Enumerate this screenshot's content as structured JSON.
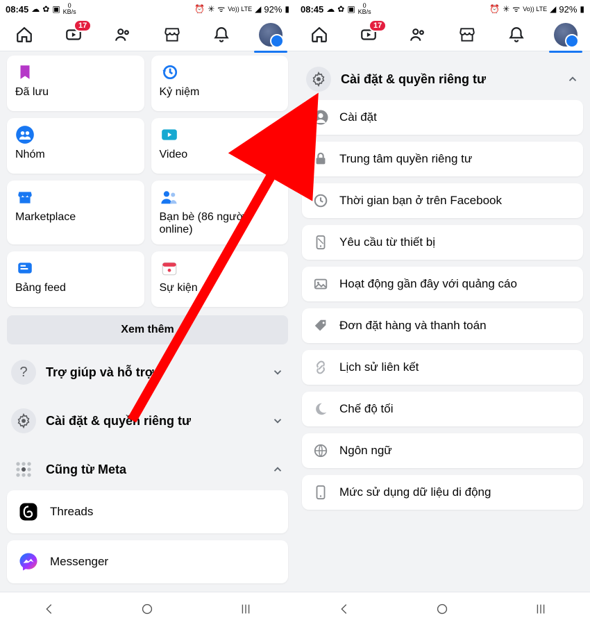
{
  "status": {
    "time": "08:45",
    "net_label": "0",
    "net_unit": "KB/s",
    "lte": "Vo)) LTE",
    "battery": "92%"
  },
  "tabs": {
    "badge": "17"
  },
  "left": {
    "tiles": [
      {
        "label": "Đã lưu"
      },
      {
        "label": "Kỷ niệm"
      },
      {
        "label": "Nhóm"
      },
      {
        "label": "Video"
      },
      {
        "label": "Marketplace"
      },
      {
        "label": "Bạn bè (86 người online)"
      },
      {
        "label": "Bảng feed"
      },
      {
        "label": "Sự kiện"
      }
    ],
    "see_more": "Xem thêm",
    "sections": [
      {
        "label": "Trợ giúp và hỗ trợ"
      },
      {
        "label": "Cài đặt & quyền riêng tư"
      },
      {
        "label": "Cũng từ Meta"
      }
    ],
    "meta_items": [
      {
        "label": "Threads"
      },
      {
        "label": "Messenger"
      }
    ]
  },
  "right": {
    "header": "Cài đặt & quyền riêng tư",
    "items": [
      {
        "label": "Cài đặt"
      },
      {
        "label": "Trung tâm quyền riêng tư"
      },
      {
        "label": "Thời gian bạn ở trên Facebook"
      },
      {
        "label": "Yêu cầu từ thiết bị"
      },
      {
        "label": "Hoạt động gần đây với quảng cáo"
      },
      {
        "label": "Đơn đặt hàng và thanh toán"
      },
      {
        "label": "Lịch sử liên kết"
      },
      {
        "label": "Chế độ tối"
      },
      {
        "label": "Ngôn ngữ"
      },
      {
        "label": "Mức sử dụng dữ liệu di động"
      }
    ]
  }
}
